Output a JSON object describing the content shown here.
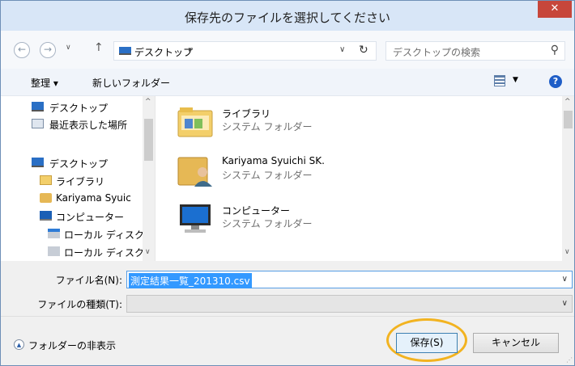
{
  "title": "保存先のファイルを選択してください",
  "close_icon": "✕",
  "address": {
    "back_icon": "←",
    "forward_icon": "→",
    "up_icon": "↑",
    "location": "デスクトップ",
    "separator_icon": "▸",
    "dropdown_icon": "∨",
    "refresh_icon": "↻"
  },
  "search": {
    "placeholder": "デスクトップの検索",
    "icon": "⚲"
  },
  "toolbar": {
    "organize": "整理 ▾",
    "new_folder": "新しいフォルダー",
    "view_dropdown": "▼",
    "help": "?"
  },
  "nav": {
    "items": [
      {
        "label": "デスクトップ"
      },
      {
        "label": "最近表示した場所"
      },
      {
        "label": "デスクトップ"
      },
      {
        "label": "ライブラリ"
      },
      {
        "label": "Kariyama Syuic"
      },
      {
        "label": "コンピューター"
      },
      {
        "label": "ローカル ディスク"
      },
      {
        "label": "ローカル ディスク"
      }
    ],
    "scroll_up": "^",
    "scroll_down": "∨"
  },
  "files": {
    "items": [
      {
        "name": "ライブラリ",
        "type": "システム フォルダー"
      },
      {
        "name": "Kariyama Syuichi SK.",
        "type": "システム フォルダー"
      },
      {
        "name": "コンピューター",
        "type": "システム フォルダー"
      }
    ],
    "scroll_up": "^",
    "scroll_down": "∨"
  },
  "form": {
    "filename_label": "ファイル名(N):",
    "filename_value": "測定結果一覧_201310.csv",
    "filetype_label": "ファイルの種類(T):",
    "dropdown_icon": "∨"
  },
  "bottom": {
    "hide_folders_label": "フォルダーの非表示",
    "hide_icon": "▲",
    "save_label": "保存(S)",
    "cancel_label": "キャンセル",
    "highlight_color": "#f2b320"
  }
}
